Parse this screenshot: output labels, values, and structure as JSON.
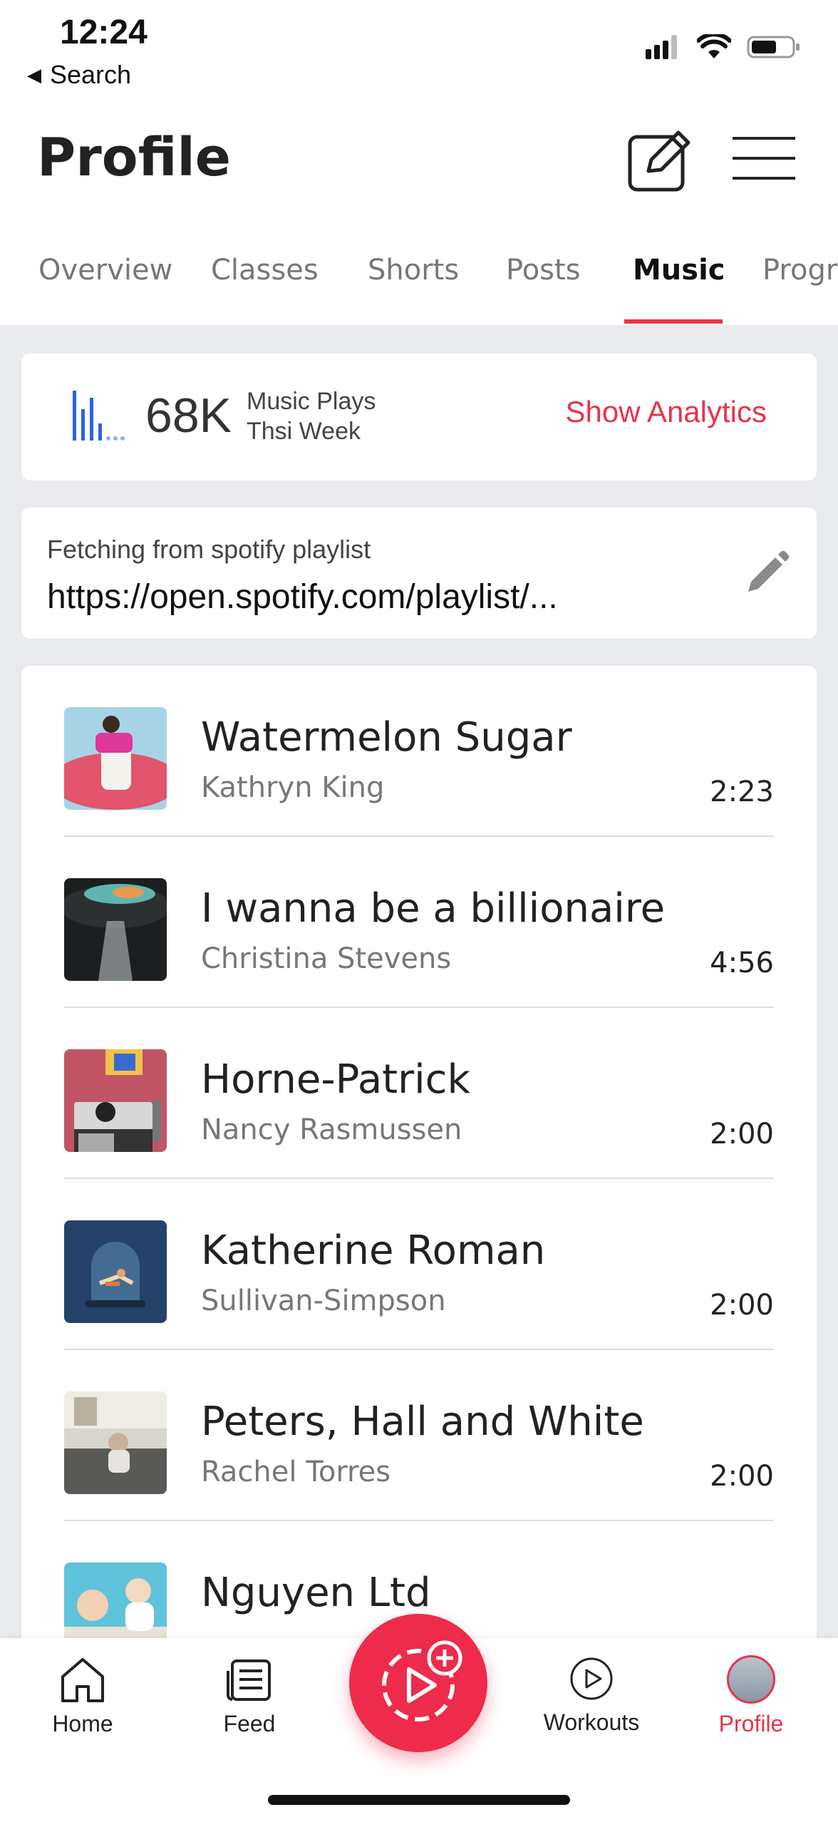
{
  "status_bar": {
    "time": "12:24",
    "back_label": "Search",
    "icons": [
      "signal-icon",
      "wifi-icon",
      "battery-icon"
    ]
  },
  "header": {
    "title": "Profile",
    "icons": [
      "edit-icon",
      "menu-icon"
    ]
  },
  "tabs": [
    {
      "label": "Overview",
      "active": false
    },
    {
      "label": "Classes",
      "active": false
    },
    {
      "label": "Shorts",
      "active": false
    },
    {
      "label": "Posts",
      "active": false
    },
    {
      "label": "Music",
      "active": true
    },
    {
      "label": "Progr",
      "active": false
    }
  ],
  "analytics": {
    "value": "68K",
    "label_line1": "Music Plays",
    "label_line2": "Thsi Week",
    "action": "Show Analytics",
    "icon": "bar-chart-icon"
  },
  "spotify": {
    "caption": "Fetching from spotify playlist",
    "url": "https://open.spotify.com/playlist/...",
    "icon": "pencil-icon"
  },
  "tracks": [
    {
      "title": "Watermelon Sugar",
      "artist": "Kathryn King",
      "duration": "2:23"
    },
    {
      "title": "I wanna be a billionaire",
      "artist": "Christina Stevens",
      "duration": "4:56"
    },
    {
      "title": "Horne-Patrick",
      "artist": "Nancy Rasmussen",
      "duration": "2:00"
    },
    {
      "title": "Katherine Roman",
      "artist": "Sullivan-Simpson",
      "duration": "2:00"
    },
    {
      "title": "Peters, Hall and White",
      "artist": "Rachel Torres",
      "duration": "2:00"
    },
    {
      "title": "Nguyen Ltd",
      "artist": "",
      "duration": ""
    }
  ],
  "bottom_nav": {
    "home": "Home",
    "feed": "Feed",
    "workouts": "Workouts",
    "profile": "Profile",
    "fab_icon": "create-video-icon"
  },
  "colors": {
    "accent": "#e8344a",
    "chart_blue": "#2a63e6"
  }
}
